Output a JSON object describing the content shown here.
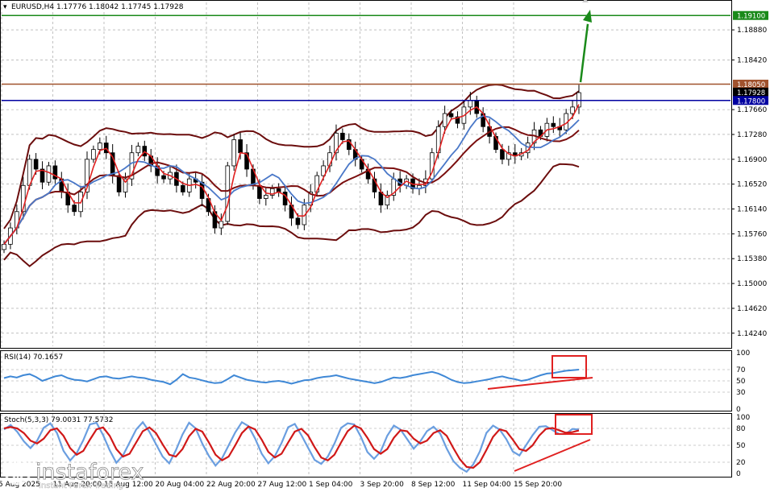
{
  "header": {
    "symbol_line": "EURUSD,H4  1.17776 1.18042 1.17745 1.17928"
  },
  "chart_data": {
    "type": "candlestick",
    "symbol": "EURUSD",
    "timeframe": "H4",
    "ohlc": {
      "open": 1.17776,
      "high": 1.18042,
      "low": 1.17745,
      "close": 1.17928
    },
    "y_axis_ticks": [
      "1.18880",
      "1.18420",
      "1.17660",
      "1.17280",
      "1.16900",
      "1.16520",
      "1.16140",
      "1.15760",
      "1.15380",
      "1.15000",
      "1.14620",
      "1.14240"
    ],
    "ylim": [
      1.1404,
      1.193
    ],
    "x_axis_ticks": [
      "5 Aug 2025",
      "11 Aug 20:00",
      "15 Aug 12:00",
      "20 Aug 04:00",
      "22 Aug 20:00",
      "27 Aug 12:00",
      "1 Sep 04:00",
      "3 Sep 20:00",
      "8 Sep 12:00",
      "11 Sep 04:00",
      "15 Sep 20:00"
    ],
    "horizontal_levels": [
      {
        "price": 1.191,
        "label": "1.19100",
        "color": "#1a8a1a"
      },
      {
        "price": 1.1805,
        "label": "1.18050",
        "color": "#a0522d"
      },
      {
        "price": 1.17928,
        "label": "1.17928",
        "color": "#000000"
      },
      {
        "price": 1.178,
        "label": "1.17800",
        "color": "#0000a0"
      }
    ],
    "closes": [
      1.156,
      1.1585,
      1.161,
      1.165,
      1.169,
      1.1675,
      1.1655,
      1.168,
      1.166,
      1.164,
      1.162,
      1.161,
      1.164,
      1.169,
      1.1705,
      1.1715,
      1.17,
      1.1665,
      1.164,
      1.166,
      1.17,
      1.171,
      1.1695,
      1.168,
      1.1665,
      1.166,
      1.167,
      1.165,
      1.164,
      1.166,
      1.1655,
      1.163,
      1.161,
      1.1585,
      1.1595,
      1.168,
      1.172,
      1.17,
      1.1675,
      1.165,
      1.163,
      1.1635,
      1.1645,
      1.164,
      1.162,
      1.16,
      1.159,
      1.162,
      1.164,
      1.1665,
      1.168,
      1.17,
      1.173,
      1.172,
      1.1705,
      1.169,
      1.1675,
      1.166,
      1.164,
      1.162,
      1.1635,
      1.166,
      1.165,
      1.166,
      1.1645,
      1.165,
      1.166,
      1.17,
      1.174,
      1.176,
      1.1755,
      1.1745,
      1.177,
      1.178,
      1.176,
      1.174,
      1.1725,
      1.1705,
      1.169,
      1.17,
      1.1695,
      1.17,
      1.1715,
      1.1735,
      1.1725,
      1.1745,
      1.174,
      1.1735,
      1.176,
      1.177,
      1.1792
    ],
    "rsi": {
      "label": "RSI(14) 70.1657",
      "ylim": [
        0,
        100
      ],
      "ticks": [
        "100",
        "70",
        "50",
        "30",
        "0"
      ],
      "values": [
        55,
        58,
        56,
        60,
        62,
        57,
        50,
        54,
        58,
        60,
        55,
        52,
        51,
        49,
        53,
        57,
        58,
        55,
        54,
        56,
        58,
        56,
        55,
        52,
        50,
        48,
        44,
        52,
        62,
        56,
        54,
        51,
        48,
        46,
        47,
        53,
        60,
        56,
        52,
        50,
        48,
        47,
        49,
        50,
        48,
        45,
        48,
        51,
        52,
        55,
        57,
        58,
        60,
        57,
        54,
        52,
        50,
        48,
        46,
        48,
        52,
        56,
        55,
        57,
        60,
        62,
        64,
        66,
        63,
        58,
        52,
        48,
        46,
        47,
        49,
        51,
        53,
        56,
        58,
        55,
        53,
        50,
        52,
        56,
        60,
        63,
        64,
        66,
        68,
        69,
        70
      ]
    },
    "stoch": {
      "label": "Stoch(5,3,3) 79.0031 77.5732",
      "ylim": [
        0,
        100
      ],
      "ticks": [
        "100",
        "80",
        "50",
        "20",
        "0"
      ],
      "values": [
        80,
        85,
        75,
        55,
        45,
        60,
        80,
        90,
        70,
        40,
        25,
        35,
        60,
        85,
        90,
        70,
        40,
        20,
        30,
        55,
        80,
        90,
        75,
        50,
        30,
        20,
        40,
        70,
        88,
        80,
        55,
        30,
        15,
        25,
        50,
        75,
        90,
        85,
        60,
        35,
        20,
        30,
        55,
        80,
        88,
        70,
        45,
        25,
        15,
        30,
        55,
        80,
        90,
        85,
        65,
        40,
        25,
        40,
        65,
        85,
        80,
        60,
        45,
        55,
        75,
        85,
        70,
        45,
        20,
        10,
        5,
        15,
        40,
        70,
        85,
        80,
        60,
        40,
        30,
        50,
        70,
        82,
        85,
        75,
        70,
        72,
        78,
        79
      ]
    },
    "annotations": [
      {
        "type": "arrow",
        "direction": "up",
        "color": "#1a8a1a"
      },
      {
        "type": "box",
        "panel": "rsi",
        "color": "#e02020"
      },
      {
        "type": "box",
        "panel": "stoch",
        "color": "#e02020"
      },
      {
        "type": "trendline",
        "panel": "rsi",
        "direction": "up",
        "color": "#e02020"
      },
      {
        "type": "trendline",
        "panel": "stoch",
        "direction": "up",
        "color": "#e02020"
      }
    ],
    "grid": true
  },
  "watermark": {
    "brand": "instaforex",
    "tagline": "Instant Forex Trading"
  }
}
